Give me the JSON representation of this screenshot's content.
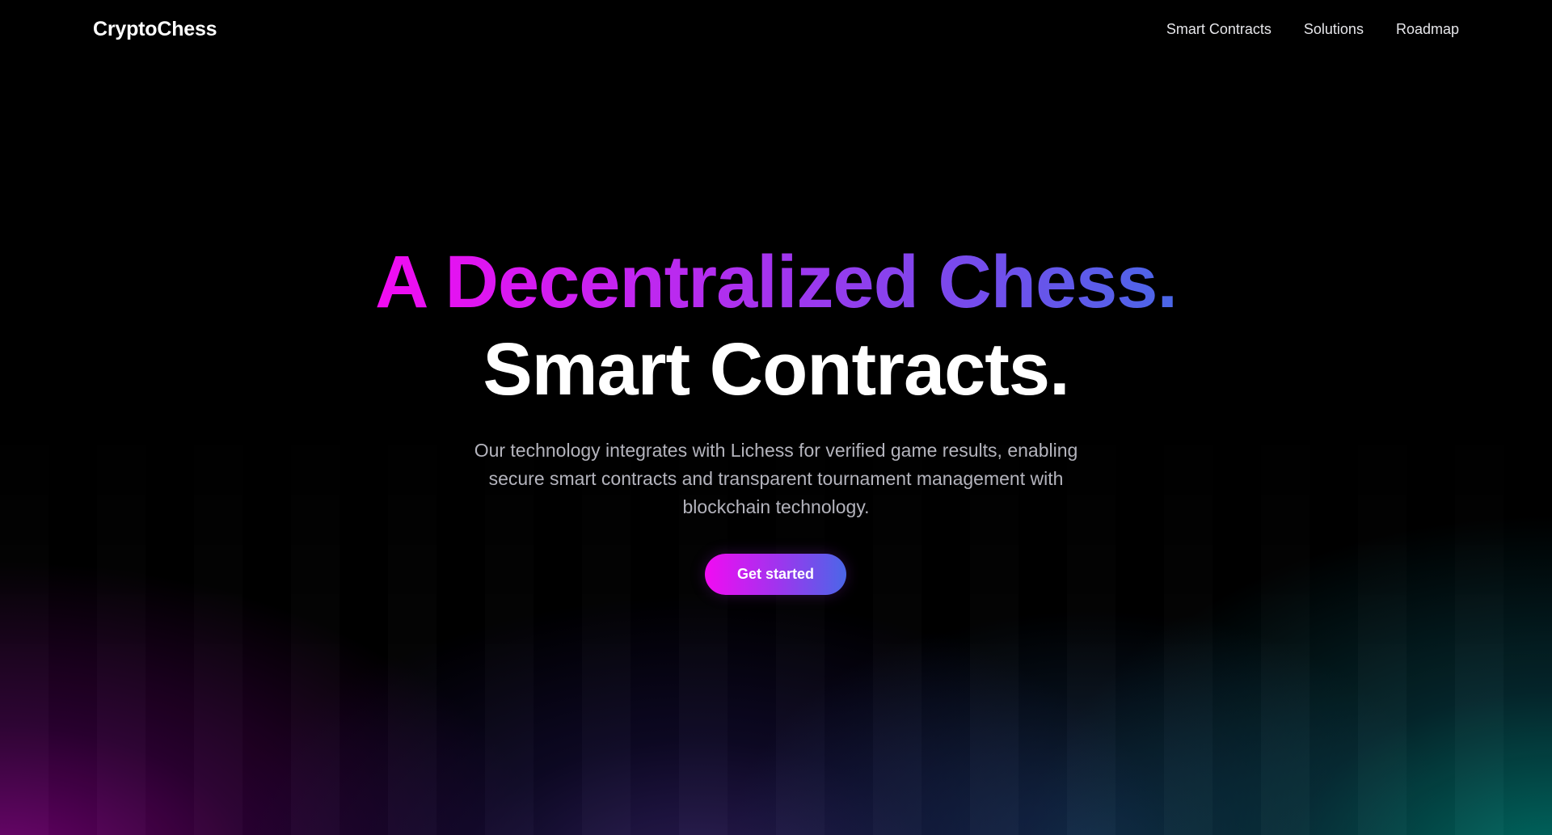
{
  "brand": {
    "name": "CryptoChess"
  },
  "nav": {
    "links": [
      "Smart Contracts",
      "Solutions",
      "Roadmap"
    ]
  },
  "hero": {
    "headline_gradient": "A Decentralized Chess.",
    "headline_white": "Smart Contracts.",
    "subtitle": "Our technology integrates with Lichess for verified game results, enabling secure smart contracts and transparent tournament management with blockchain technology.",
    "cta_label": "Get started"
  },
  "colors": {
    "background": "#000000",
    "gradient_start": "#f20bf2",
    "gradient_end": "#4a67e8",
    "glow_left": "#780078",
    "glow_right": "#00786e"
  }
}
